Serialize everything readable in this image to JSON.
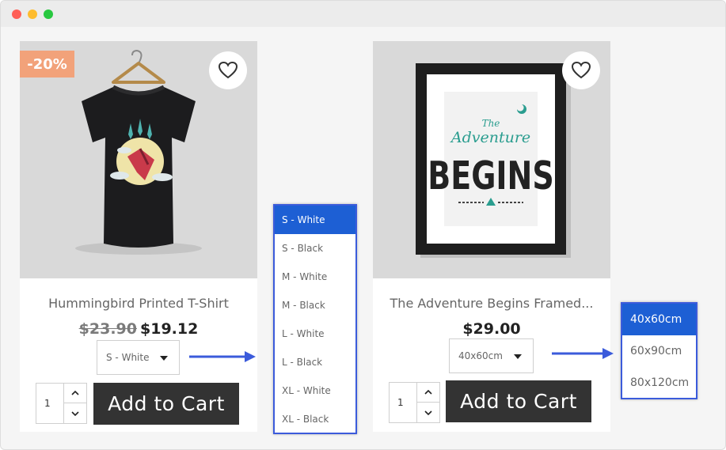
{
  "products": [
    {
      "discount_badge": "-20%",
      "name": "Hummingbird Printed T-Shirt",
      "old_price": "$23.90",
      "price": "$19.12",
      "selected_variant": "S - White",
      "quantity": "1",
      "add_to_cart_label": "Add to Cart",
      "variant_options": [
        "S - White",
        "S - Black",
        "M - White",
        "M - Black",
        "L - White",
        "L - Black",
        "XL - White",
        "XL - Black"
      ]
    },
    {
      "name": "The Adventure Begins Framed...",
      "price": "$29.00",
      "selected_variant": "40x60cm",
      "quantity": "1",
      "add_to_cart_label": "Add to Cart",
      "variant_options": [
        "40x60cm",
        "60x90cm",
        "80x120cm"
      ]
    }
  ],
  "poster_art": {
    "line1": "The",
    "line2": "Adventure",
    "line3": "BEGINS"
  },
  "colors": {
    "badge": "#f2a27a",
    "button": "#333333",
    "dropdown_selected": "#1d5fd4",
    "dropdown_border": "#3b5bdb",
    "arrow": "#3b5bdb"
  },
  "icons": {
    "wishlist": "heart-outline-icon",
    "select_caret": "caret-down-icon",
    "qty_up": "chevron-up-icon",
    "qty_down": "chevron-down-icon",
    "pointer": "arrow-right-icon"
  }
}
